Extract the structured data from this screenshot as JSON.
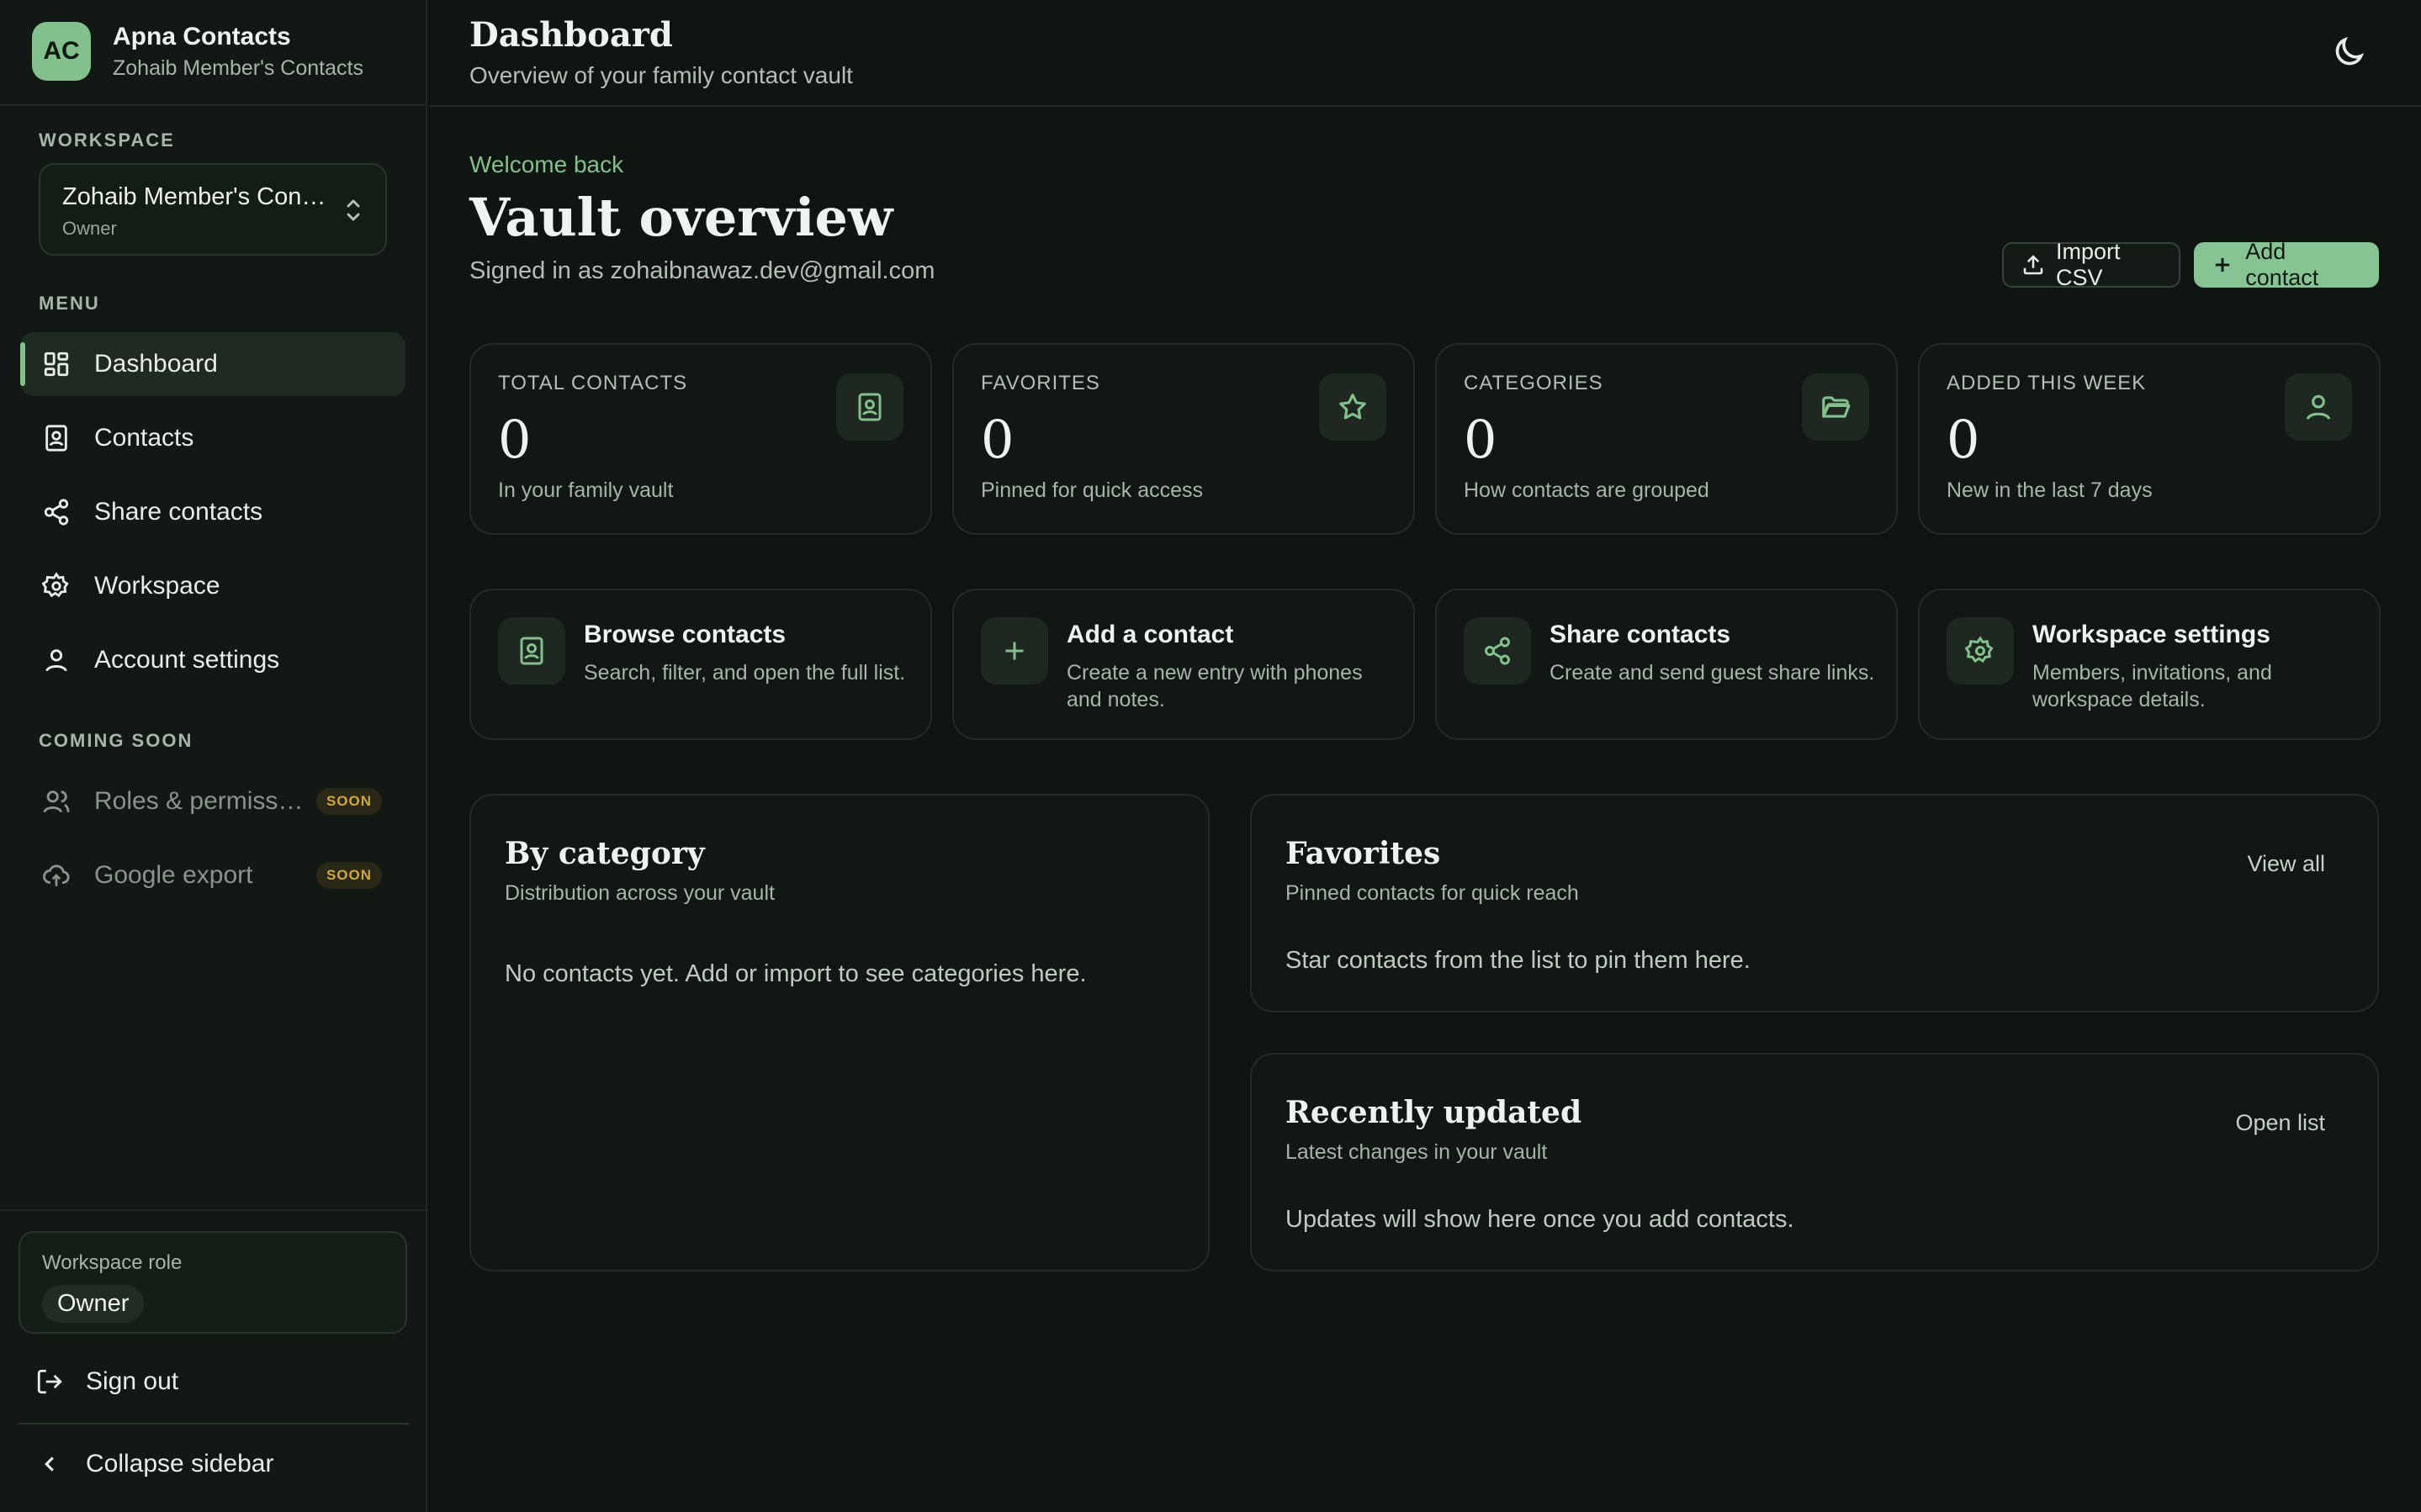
{
  "colors": {
    "accent": "#82c08c",
    "background": "#0f1511",
    "soon": "#cfa93c"
  },
  "brand": {
    "initials": "AC",
    "title": "Apna Contacts",
    "subtitle": "Zohaib Member's Contacts"
  },
  "sidebar": {
    "workspace_label": "WORKSPACE",
    "workspace_name": "Zohaib Member's Contacts",
    "workspace_role": "Owner",
    "menu_label": "MENU",
    "items": [
      {
        "label": "Dashboard",
        "icon": "dashboard-icon",
        "active": true
      },
      {
        "label": "Contacts",
        "icon": "contact-book-icon"
      },
      {
        "label": "Share contacts",
        "icon": "share-icon"
      },
      {
        "label": "Workspace",
        "icon": "gear-icon"
      },
      {
        "label": "Account settings",
        "icon": "user-icon"
      }
    ],
    "coming_soon_label": "COMING SOON",
    "soon_items": [
      {
        "label": "Roles & permissions",
        "badge": "SOON",
        "icon": "users-icon"
      },
      {
        "label": "Google export",
        "badge": "SOON",
        "icon": "cloud-upload-icon"
      }
    ],
    "role_card": {
      "label": "Workspace role",
      "value": "Owner"
    },
    "sign_out": "Sign out",
    "collapse": "Collapse sidebar"
  },
  "header": {
    "title": "Dashboard",
    "subtitle": "Overview of your family contact vault"
  },
  "main": {
    "welcome": "Welcome back",
    "title": "Vault overview",
    "signed_in": "Signed in as zohaibnawaz.dev@gmail.com",
    "import_csv": "Import CSV",
    "add_contact": "Add contact",
    "stats": [
      {
        "label": "TOTAL CONTACTS",
        "value": "0",
        "desc": "In your family vault",
        "icon": "contact-book-icon"
      },
      {
        "label": "FAVORITES",
        "value": "0",
        "desc": "Pinned for quick access",
        "icon": "star-icon"
      },
      {
        "label": "CATEGORIES",
        "value": "0",
        "desc": "How contacts are grouped",
        "icon": "folder-icon"
      },
      {
        "label": "ADDED THIS WEEK",
        "value": "0",
        "desc": "New in the last 7 days",
        "icon": "user-icon"
      }
    ],
    "actions": [
      {
        "title": "Browse contacts",
        "desc": "Search, filter, and open the full list.",
        "icon": "contact-book-icon"
      },
      {
        "title": "Add a contact",
        "desc": "Create a new entry with phones and notes.",
        "icon": "plus-icon"
      },
      {
        "title": "Share contacts",
        "desc": "Create and send guest share links.",
        "icon": "share-icon"
      },
      {
        "title": "Workspace settings",
        "desc": "Members, invitations, and workspace details.",
        "icon": "gear-icon"
      }
    ],
    "by_category": {
      "title": "By category",
      "subtitle": "Distribution across your vault",
      "empty": "No contacts yet. Add or import to see categories here."
    },
    "favorites": {
      "title": "Favorites",
      "subtitle": "Pinned contacts for quick reach",
      "link": "View all",
      "empty": "Star contacts from the list to pin them here."
    },
    "recent": {
      "title": "Recently updated",
      "subtitle": "Latest changes in your vault",
      "link": "Open list",
      "empty": "Updates will show here once you add contacts."
    }
  }
}
